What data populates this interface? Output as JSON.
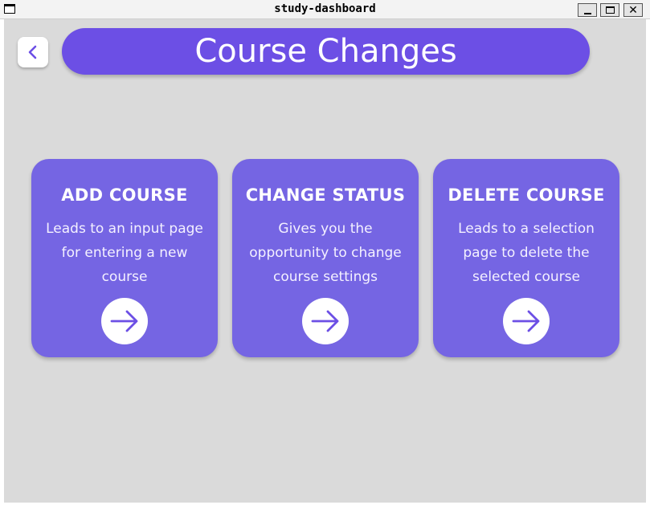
{
  "window": {
    "title": "study-dashboard"
  },
  "header": {
    "title": "Course Changes",
    "accent_color": "#6c4fe5"
  },
  "cards": [
    {
      "title": "ADD COURSE",
      "description": "Leads to an input page for entering a new course"
    },
    {
      "title": "CHANGE STATUS",
      "description": "Gives you the opportunity to change course settings"
    },
    {
      "title": "DELETE COURSE",
      "description": "Leads to a selection page to delete the selected course"
    }
  ],
  "colors": {
    "card": "#7565e3",
    "background": "#dadada"
  }
}
